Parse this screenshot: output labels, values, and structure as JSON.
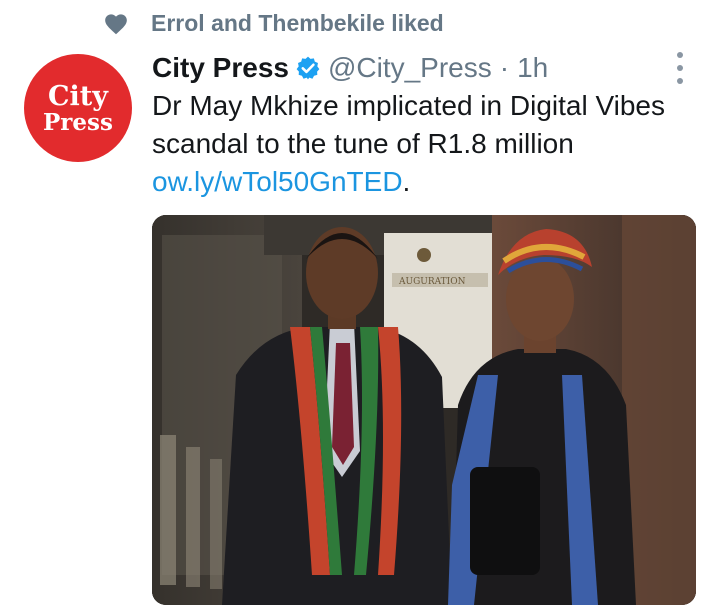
{
  "social_context": {
    "icon": "heart-icon",
    "text": "Errol and Thembekile liked"
  },
  "author": {
    "avatar_line1": "City",
    "avatar_line2": "Press",
    "name": "City Press",
    "handle": "@City_Press",
    "separator": "·",
    "time": "1h",
    "verified": true
  },
  "tweet": {
    "text": "Dr May Mkhize implicated in Digital Vibes scandal to the tune of R1.8 million",
    "link": "ow.ly/wTol50GnTED",
    "trailing": "."
  },
  "banner_text": "AUGURATION",
  "colors": {
    "accent": "#1da1f2",
    "link": "#1b95e0",
    "muted": "#657786",
    "avatar_red": "#e22b2d"
  }
}
